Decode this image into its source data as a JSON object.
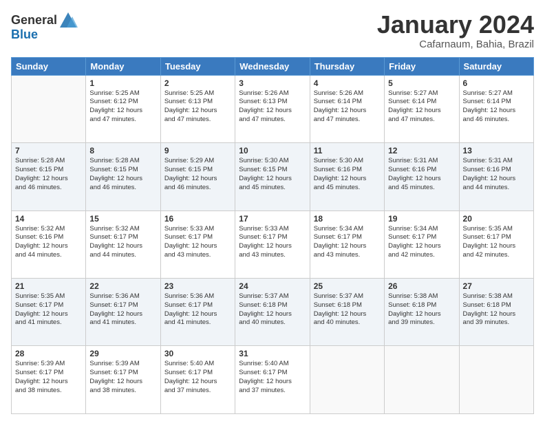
{
  "header": {
    "logo_line1": "General",
    "logo_line2": "Blue",
    "month_title": "January 2024",
    "subtitle": "Cafarnaum, Bahia, Brazil"
  },
  "calendar": {
    "headers": [
      "Sunday",
      "Monday",
      "Tuesday",
      "Wednesday",
      "Thursday",
      "Friday",
      "Saturday"
    ],
    "weeks": [
      [
        {
          "day": "",
          "info": ""
        },
        {
          "day": "1",
          "info": "Sunrise: 5:25 AM\nSunset: 6:12 PM\nDaylight: 12 hours\nand 47 minutes."
        },
        {
          "day": "2",
          "info": "Sunrise: 5:25 AM\nSunset: 6:13 PM\nDaylight: 12 hours\nand 47 minutes."
        },
        {
          "day": "3",
          "info": "Sunrise: 5:26 AM\nSunset: 6:13 PM\nDaylight: 12 hours\nand 47 minutes."
        },
        {
          "day": "4",
          "info": "Sunrise: 5:26 AM\nSunset: 6:14 PM\nDaylight: 12 hours\nand 47 minutes."
        },
        {
          "day": "5",
          "info": "Sunrise: 5:27 AM\nSunset: 6:14 PM\nDaylight: 12 hours\nand 47 minutes."
        },
        {
          "day": "6",
          "info": "Sunrise: 5:27 AM\nSunset: 6:14 PM\nDaylight: 12 hours\nand 46 minutes."
        }
      ],
      [
        {
          "day": "7",
          "info": "Sunrise: 5:28 AM\nSunset: 6:15 PM\nDaylight: 12 hours\nand 46 minutes."
        },
        {
          "day": "8",
          "info": "Sunrise: 5:28 AM\nSunset: 6:15 PM\nDaylight: 12 hours\nand 46 minutes."
        },
        {
          "day": "9",
          "info": "Sunrise: 5:29 AM\nSunset: 6:15 PM\nDaylight: 12 hours\nand 46 minutes."
        },
        {
          "day": "10",
          "info": "Sunrise: 5:30 AM\nSunset: 6:15 PM\nDaylight: 12 hours\nand 45 minutes."
        },
        {
          "day": "11",
          "info": "Sunrise: 5:30 AM\nSunset: 6:16 PM\nDaylight: 12 hours\nand 45 minutes."
        },
        {
          "day": "12",
          "info": "Sunrise: 5:31 AM\nSunset: 6:16 PM\nDaylight: 12 hours\nand 45 minutes."
        },
        {
          "day": "13",
          "info": "Sunrise: 5:31 AM\nSunset: 6:16 PM\nDaylight: 12 hours\nand 44 minutes."
        }
      ],
      [
        {
          "day": "14",
          "info": "Sunrise: 5:32 AM\nSunset: 6:16 PM\nDaylight: 12 hours\nand 44 minutes."
        },
        {
          "day": "15",
          "info": "Sunrise: 5:32 AM\nSunset: 6:17 PM\nDaylight: 12 hours\nand 44 minutes."
        },
        {
          "day": "16",
          "info": "Sunrise: 5:33 AM\nSunset: 6:17 PM\nDaylight: 12 hours\nand 43 minutes."
        },
        {
          "day": "17",
          "info": "Sunrise: 5:33 AM\nSunset: 6:17 PM\nDaylight: 12 hours\nand 43 minutes."
        },
        {
          "day": "18",
          "info": "Sunrise: 5:34 AM\nSunset: 6:17 PM\nDaylight: 12 hours\nand 43 minutes."
        },
        {
          "day": "19",
          "info": "Sunrise: 5:34 AM\nSunset: 6:17 PM\nDaylight: 12 hours\nand 42 minutes."
        },
        {
          "day": "20",
          "info": "Sunrise: 5:35 AM\nSunset: 6:17 PM\nDaylight: 12 hours\nand 42 minutes."
        }
      ],
      [
        {
          "day": "21",
          "info": "Sunrise: 5:35 AM\nSunset: 6:17 PM\nDaylight: 12 hours\nand 41 minutes."
        },
        {
          "day": "22",
          "info": "Sunrise: 5:36 AM\nSunset: 6:17 PM\nDaylight: 12 hours\nand 41 minutes."
        },
        {
          "day": "23",
          "info": "Sunrise: 5:36 AM\nSunset: 6:17 PM\nDaylight: 12 hours\nand 41 minutes."
        },
        {
          "day": "24",
          "info": "Sunrise: 5:37 AM\nSunset: 6:18 PM\nDaylight: 12 hours\nand 40 minutes."
        },
        {
          "day": "25",
          "info": "Sunrise: 5:37 AM\nSunset: 6:18 PM\nDaylight: 12 hours\nand 40 minutes."
        },
        {
          "day": "26",
          "info": "Sunrise: 5:38 AM\nSunset: 6:18 PM\nDaylight: 12 hours\nand 39 minutes."
        },
        {
          "day": "27",
          "info": "Sunrise: 5:38 AM\nSunset: 6:18 PM\nDaylight: 12 hours\nand 39 minutes."
        }
      ],
      [
        {
          "day": "28",
          "info": "Sunrise: 5:39 AM\nSunset: 6:17 PM\nDaylight: 12 hours\nand 38 minutes."
        },
        {
          "day": "29",
          "info": "Sunrise: 5:39 AM\nSunset: 6:17 PM\nDaylight: 12 hours\nand 38 minutes."
        },
        {
          "day": "30",
          "info": "Sunrise: 5:40 AM\nSunset: 6:17 PM\nDaylight: 12 hours\nand 37 minutes."
        },
        {
          "day": "31",
          "info": "Sunrise: 5:40 AM\nSunset: 6:17 PM\nDaylight: 12 hours\nand 37 minutes."
        },
        {
          "day": "",
          "info": ""
        },
        {
          "day": "",
          "info": ""
        },
        {
          "day": "",
          "info": ""
        }
      ]
    ]
  }
}
